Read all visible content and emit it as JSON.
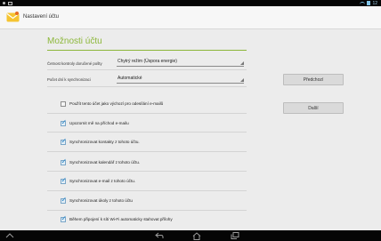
{
  "status_bar": {
    "time": "12"
  },
  "action_bar": {
    "title": "Nastavení účtu"
  },
  "settings": {
    "section_title": "Možnosti účtu",
    "check_frequency": {
      "label": "Četnost kontroly doručené pošty",
      "value": "Chytrý režim (Úspora energie)"
    },
    "sync_days": {
      "label": "Počet dní k synchronizaci",
      "value": "Automatické"
    },
    "checkboxes": [
      {
        "label": "Použít tento účet jako výchozí pro odesílání e-mailů",
        "checked": false
      },
      {
        "label": "Upozornit mě na příchod e-mailu",
        "checked": true
      },
      {
        "label": "Synchronizovat kontakty z tohoto účtu.",
        "checked": true
      },
      {
        "label": "Synchronizovat kalendář z tohoto účtu.",
        "checked": true
      },
      {
        "label": "Synchronizovat e-mail z tohoto účtu.",
        "checked": true
      },
      {
        "label": "Synchronizovat úkoly z tohoto účtu",
        "checked": true
      },
      {
        "label": "Během připojení k síti Wi-Fi automaticky stahovat přílohy",
        "checked": true
      }
    ]
  },
  "buttons": {
    "previous": "Předchozí",
    "next": "Další"
  },
  "nav_bar": {
    "icons": [
      "home-up-icon",
      "back-icon",
      "home-icon",
      "recent-apps-icon"
    ]
  },
  "colors": {
    "accent": "#8cb73a",
    "check": "#2a86c7"
  }
}
